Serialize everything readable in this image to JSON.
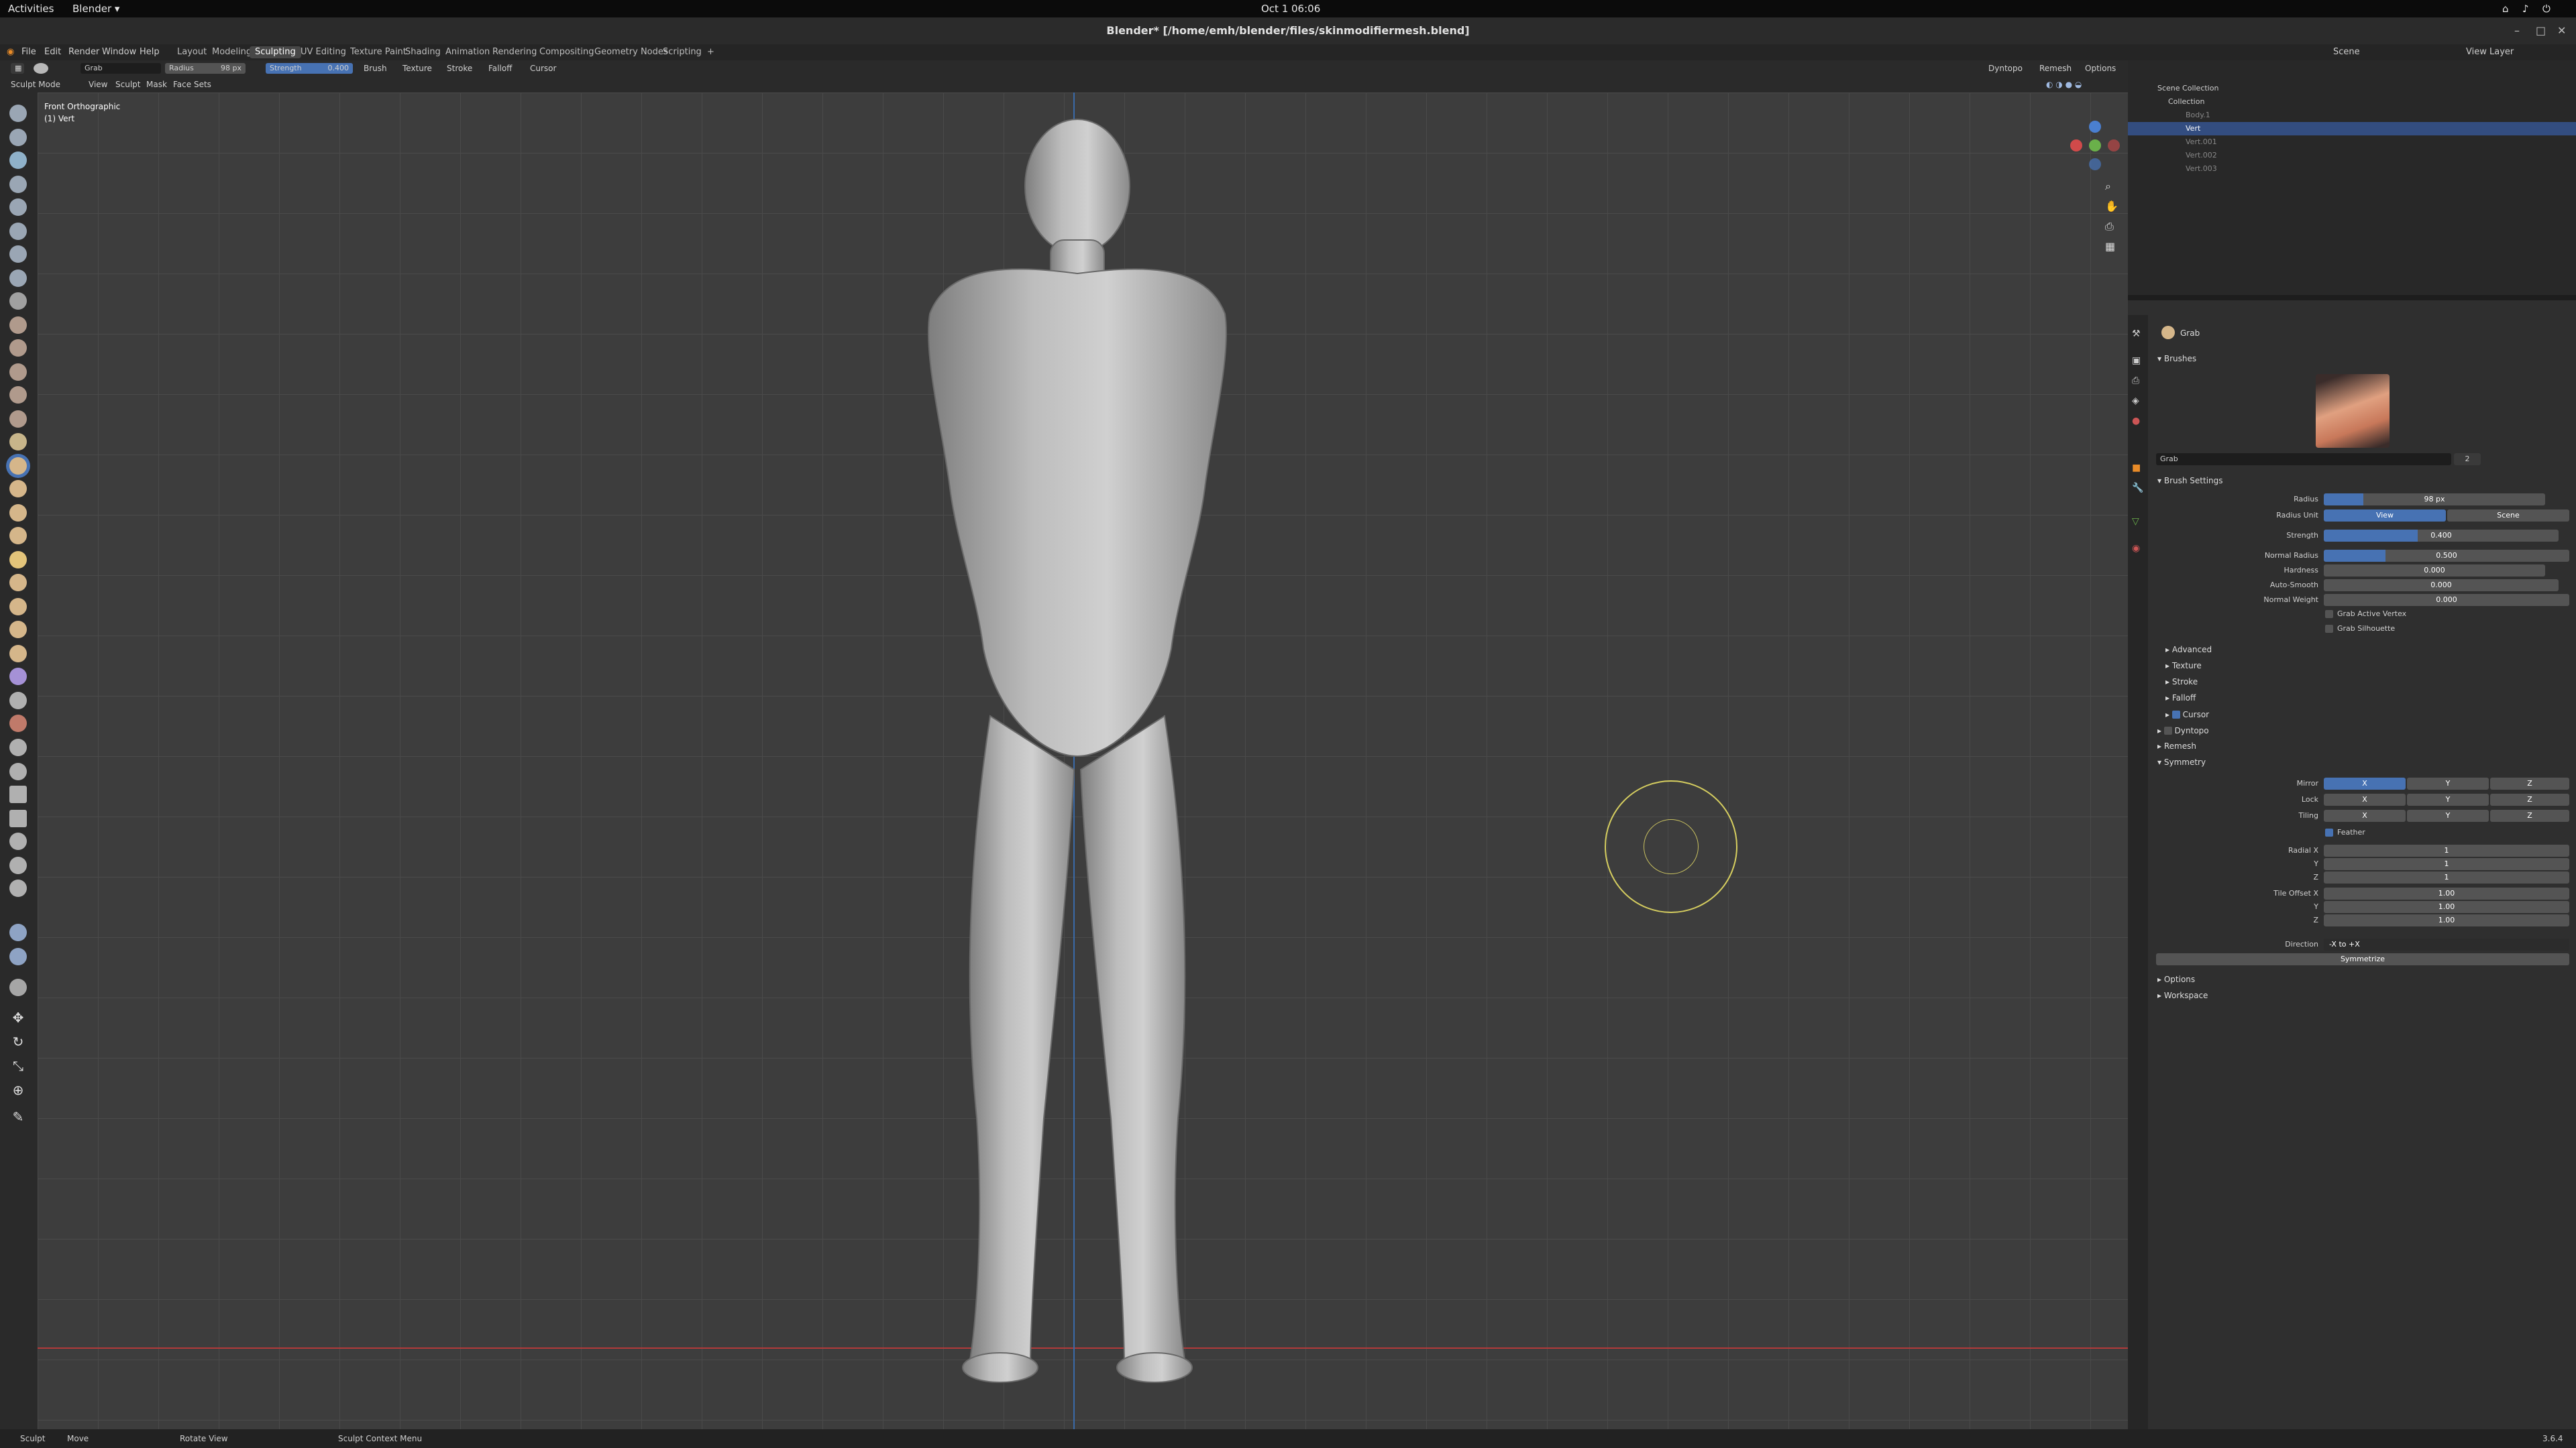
{
  "gnome": {
    "activities": "Activities",
    "app": "Blender ▾",
    "clock": "Oct 1  06:06"
  },
  "title": "Blender* [/home/emh/blender/files/skinmodifiermesh.blend]",
  "menus": [
    "File",
    "Edit",
    "Render",
    "Window",
    "Help"
  ],
  "workspaces": [
    "Layout",
    "Modeling",
    "Sculpting",
    "UV Editing",
    "Texture Paint",
    "Shading",
    "Animation",
    "Rendering",
    "Compositing",
    "Geometry Nodes",
    "Scripting",
    "+"
  ],
  "active_workspace": "Sculpting",
  "scene": {
    "label": "Scene",
    "view_layer": "View Layer"
  },
  "toolhdr": {
    "brush": "Grab",
    "radius_label": "Radius",
    "radius": "98 px",
    "strength_label": "Strength",
    "strength": "0.400",
    "menus": [
      "Brush",
      "Texture",
      "Stroke",
      "Falloff",
      "Cursor"
    ],
    "right": [
      "Dyntopo",
      "Remesh",
      "Options"
    ]
  },
  "viewhdr": {
    "mode": "Sculpt Mode",
    "menus": [
      "View",
      "Sculpt",
      "Mask",
      "Face Sets"
    ]
  },
  "overlay": {
    "line1": "Front Orthographic",
    "line2": "(1) Vert"
  },
  "outliner": {
    "rows": [
      {
        "name": "Scene Collection"
      },
      {
        "name": "Collection"
      },
      {
        "name": "Body.1"
      },
      {
        "name": "Vert"
      },
      {
        "name": "Vert.001"
      },
      {
        "name": "Vert.002"
      },
      {
        "name": "Vert.003"
      }
    ]
  },
  "props": {
    "tool_name": "Grab",
    "brushes": "Brushes",
    "brush_field": "Grab",
    "brush_users": "2",
    "brush_settings": "Brush Settings",
    "radius": {
      "label": "Radius",
      "value": "98 px",
      "frac": 0.18
    },
    "radius_unit": {
      "label": "Radius Unit",
      "a": "View",
      "b": "Scene"
    },
    "strength": {
      "label": "Strength",
      "value": "0.400",
      "frac": 0.4
    },
    "normal_radius": {
      "label": "Normal Radius",
      "value": "0.500",
      "frac": 0.25
    },
    "hardness": {
      "label": "Hardness",
      "value": "0.000",
      "frac": 0
    },
    "auto_smooth": {
      "label": "Auto-Smooth",
      "value": "0.000",
      "frac": 0
    },
    "normal_weight": {
      "label": "Normal Weight",
      "value": "0.000",
      "frac": 0
    },
    "grab_active_vertex": "Grab Active Vertex",
    "grab_silhouette": "Grab Silhouette",
    "subpanels": [
      "Advanced",
      "Texture",
      "Stroke",
      "Falloff",
      "Cursor"
    ],
    "dyntopo": "Dyntopo",
    "remesh": "Remesh",
    "symmetry": "Symmetry",
    "mirror": "Mirror",
    "lock": "Lock",
    "tiling": "Tiling",
    "x": "X",
    "y": "Y",
    "z": "Z",
    "feather": "Feather",
    "radial_x": "Radial X",
    "radial_y": "Y",
    "radial_z": "Z",
    "radial_vals": [
      "1",
      "1",
      "1"
    ],
    "tile_offset_x": "Tile Offset X",
    "tile_y": "Y",
    "tile_z": "Z",
    "tile_vals": [
      "1.00",
      "1.00",
      "1.00"
    ],
    "direction": "Direction",
    "direction_val": "-X to +X",
    "symmetrize": "Symmetrize",
    "options": "Options",
    "workspace": "Workspace"
  },
  "status": {
    "sculpt": "Sculpt",
    "move": "Move",
    "rotate": "Rotate View",
    "context": "Sculpt Context Menu",
    "version": "3.6.4"
  }
}
